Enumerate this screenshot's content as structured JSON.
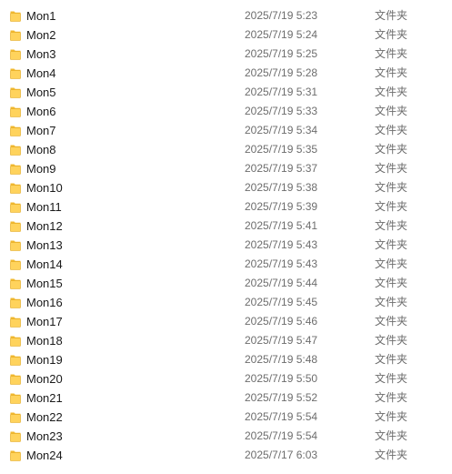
{
  "file_list": {
    "icon": "folder-icon",
    "icon_colors": {
      "body": "#ffd35c",
      "body_edge": "#e0a418",
      "tab": "#f1b92f"
    },
    "items": [
      {
        "name": "Mon1",
        "date_modified": "2025/7/19 5:23",
        "type": "文件夹"
      },
      {
        "name": "Mon2",
        "date_modified": "2025/7/19 5:24",
        "type": "文件夹"
      },
      {
        "name": "Mon3",
        "date_modified": "2025/7/19 5:25",
        "type": "文件夹"
      },
      {
        "name": "Mon4",
        "date_modified": "2025/7/19 5:28",
        "type": "文件夹"
      },
      {
        "name": "Mon5",
        "date_modified": "2025/7/19 5:31",
        "type": "文件夹"
      },
      {
        "name": "Mon6",
        "date_modified": "2025/7/19 5:33",
        "type": "文件夹"
      },
      {
        "name": "Mon7",
        "date_modified": "2025/7/19 5:34",
        "type": "文件夹"
      },
      {
        "name": "Mon8",
        "date_modified": "2025/7/19 5:35",
        "type": "文件夹"
      },
      {
        "name": "Mon9",
        "date_modified": "2025/7/19 5:37",
        "type": "文件夹"
      },
      {
        "name": "Mon10",
        "date_modified": "2025/7/19 5:38",
        "type": "文件夹"
      },
      {
        "name": "Mon11",
        "date_modified": "2025/7/19 5:39",
        "type": "文件夹"
      },
      {
        "name": "Mon12",
        "date_modified": "2025/7/19 5:41",
        "type": "文件夹"
      },
      {
        "name": "Mon13",
        "date_modified": "2025/7/19 5:43",
        "type": "文件夹"
      },
      {
        "name": "Mon14",
        "date_modified": "2025/7/19 5:43",
        "type": "文件夹"
      },
      {
        "name": "Mon15",
        "date_modified": "2025/7/19 5:44",
        "type": "文件夹"
      },
      {
        "name": "Mon16",
        "date_modified": "2025/7/19 5:45",
        "type": "文件夹"
      },
      {
        "name": "Mon17",
        "date_modified": "2025/7/19 5:46",
        "type": "文件夹"
      },
      {
        "name": "Mon18",
        "date_modified": "2025/7/19 5:47",
        "type": "文件夹"
      },
      {
        "name": "Mon19",
        "date_modified": "2025/7/19 5:48",
        "type": "文件夹"
      },
      {
        "name": "Mon20",
        "date_modified": "2025/7/19 5:50",
        "type": "文件夹"
      },
      {
        "name": "Mon21",
        "date_modified": "2025/7/19 5:52",
        "type": "文件夹"
      },
      {
        "name": "Mon22",
        "date_modified": "2025/7/19 5:54",
        "type": "文件夹"
      },
      {
        "name": "Mon23",
        "date_modified": "2025/7/19 5:54",
        "type": "文件夹"
      },
      {
        "name": "Mon24",
        "date_modified": "2025/7/17 6:03",
        "type": "文件夹"
      }
    ]
  }
}
